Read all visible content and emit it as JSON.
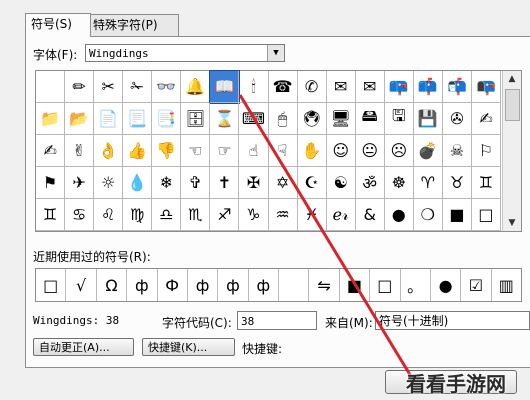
{
  "tabs": [
    {
      "label": "符号(S)",
      "active": true
    },
    {
      "label": "特殊字符(P)",
      "active": false
    }
  ],
  "font": {
    "label": "字体(F):",
    "value": "Wingdings"
  },
  "symbol_grid": {
    "rows": [
      [
        "",
        "✏",
        "✂",
        "✁",
        "👓",
        "🔔",
        "📖",
        "🕯",
        "☎",
        "✆",
        "✉",
        "✉",
        "📪",
        "📫",
        "📬",
        "📭"
      ],
      [
        "📁",
        "📂",
        "📄",
        "📃",
        "📑",
        "🗄",
        "⌛",
        "⌨",
        "🖱",
        "🖲",
        "🖥",
        "🖴",
        "🖫",
        "💾",
        "✇",
        "✍"
      ],
      [
        "✍",
        "✌",
        "👌",
        "👍",
        "👎",
        "☜",
        "☞",
        "☝",
        "☟",
        "✋",
        "☺",
        "😐",
        "☹",
        "💣",
        "☠",
        "⚐"
      ],
      [
        "⚑",
        "✈",
        "☼",
        "💧",
        "❄",
        "✞",
        "✝",
        "✠",
        "✡",
        "☪",
        "☯",
        "ॐ",
        "☸",
        "♈",
        "♉",
        "♊"
      ],
      [
        "♊",
        "♋",
        "♌",
        "♍",
        "♎",
        "♏",
        "♐",
        "♑",
        "♒",
        "♓",
        "ℯ𝓇",
        "&",
        "●",
        "❍",
        "■",
        "□"
      ]
    ],
    "selected": "0,6"
  },
  "recent": {
    "label": "近期使用过的符号(R):",
    "items": [
      "□",
      "√",
      "Ω",
      "ф",
      "Ф",
      "ф",
      "ф",
      "ф",
      "",
      "⇋",
      "■",
      "□",
      "。",
      "●",
      "☑",
      "▥"
    ]
  },
  "info": {
    "font_code": "Wingdings: 38",
    "code_label": "字符代码(C):",
    "code_value": "38",
    "from_label": "来自(M):",
    "from_value": "符号(十进制)"
  },
  "buttons": {
    "autocorrect": "自动更正(A)...",
    "shortcut_key": "快捷键(K)...",
    "shortcut_label": "快捷键:"
  },
  "watermark": "看看手游网",
  "colors": {
    "selection": "#3c7fd6",
    "arrow": "#d8232a"
  }
}
